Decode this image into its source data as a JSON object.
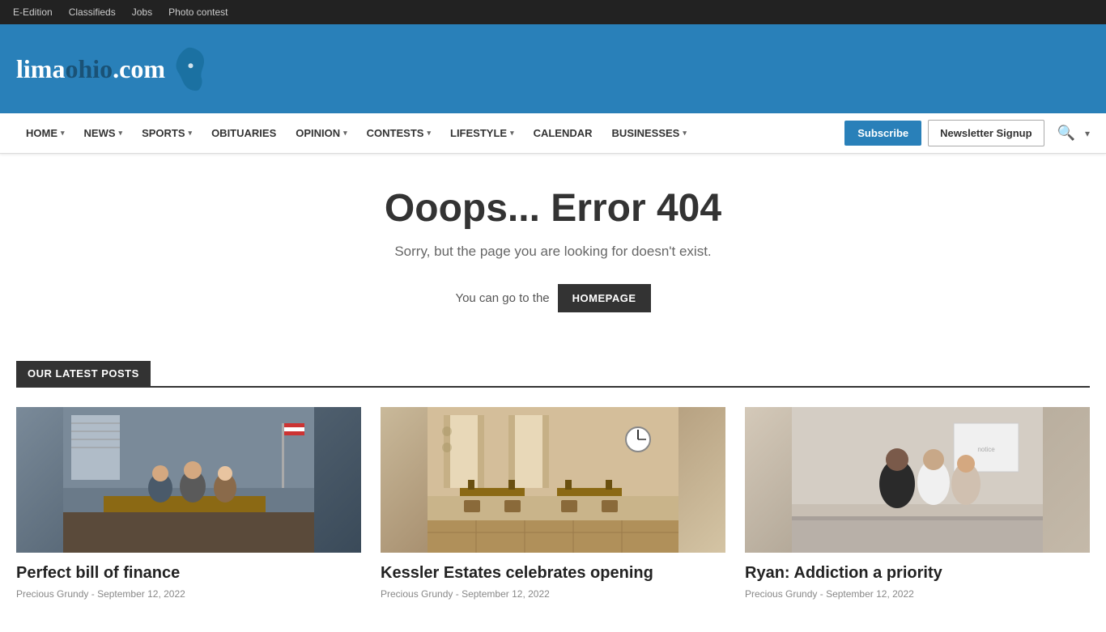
{
  "topbar": {
    "links": [
      {
        "label": "E-Edition",
        "href": "#"
      },
      {
        "label": "Classifieds",
        "href": "#"
      },
      {
        "label": "Jobs",
        "href": "#"
      },
      {
        "label": "Photo contest",
        "href": "#"
      }
    ]
  },
  "logo": {
    "text_lima": "lima",
    "text_ohio": "ohio",
    "text_domain": ".com"
  },
  "nav": {
    "items": [
      {
        "label": "HOME",
        "has_dropdown": true
      },
      {
        "label": "NEWS",
        "has_dropdown": true
      },
      {
        "label": "SPORTS",
        "has_dropdown": true
      },
      {
        "label": "OBITUARIES",
        "has_dropdown": false
      },
      {
        "label": "OPINION",
        "has_dropdown": true
      },
      {
        "label": "CONTESTS",
        "has_dropdown": true
      },
      {
        "label": "LIFESTYLE",
        "has_dropdown": true
      },
      {
        "label": "CALENDAR",
        "has_dropdown": false
      },
      {
        "label": "BUSINESSES",
        "has_dropdown": true
      }
    ],
    "subscribe_label": "Subscribe",
    "newsletter_label": "Newsletter Signup"
  },
  "error_page": {
    "title": "Ooops... Error 404",
    "subtitle": "Sorry, but the page you are looking for doesn't exist.",
    "go_to_text": "You can go to the",
    "homepage_button": "HOMEPAGE"
  },
  "latest_posts": {
    "section_label": "OUR LATEST POSTS",
    "posts": [
      {
        "title": "Perfect bill of finance",
        "author": "Precious Grundy",
        "date": "September 12, 2022",
        "image_alt": "City council meeting"
      },
      {
        "title": "Kessler Estates celebrates opening",
        "author": "Precious Grundy",
        "date": "September 12, 2022",
        "image_alt": "Kessler Estates dining room"
      },
      {
        "title": "Ryan: Addiction a priority",
        "author": "Precious Grundy",
        "date": "September 12, 2022",
        "image_alt": "Ryan speaking with community members"
      }
    ]
  }
}
